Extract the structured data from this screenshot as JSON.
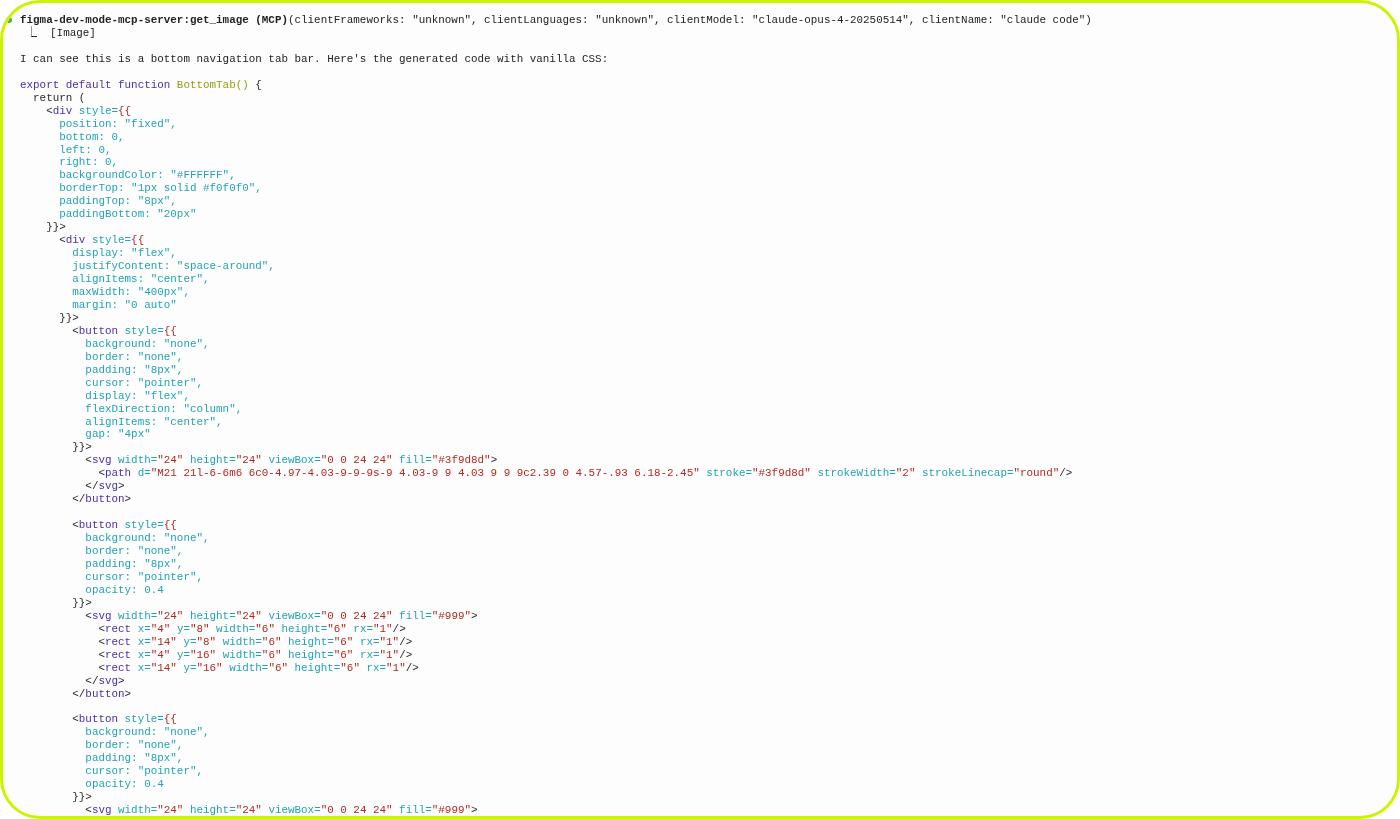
{
  "tool_call": {
    "title": "**figma-dev-mode-mcp-server:get_image (MCP)**(clientFrameworks: \"unknown\", clientLanguages: \"unknown\", clientModel: \"claude-opus-4-20250514\", clientName: \"claude code\")",
    "result": "⎿  [Image]"
  },
  "message": "I can see this is a bottom navigation tab bar. Here's the generated code with vanilla CSS:",
  "code_lines": [
    {
      "kind": "code",
      "tokens": [
        {
          "kind": "keyword",
          "text": "export default function "
        },
        {
          "kind": "function",
          "text": "BottomTab()"
        },
        {
          "kind": "plain",
          "text": " {"
        }
      ]
    },
    {
      "kind": "code",
      "tokens": [
        {
          "kind": "plain",
          "text": "  return ("
        }
      ]
    },
    {
      "kind": "code",
      "tokens": [
        {
          "kind": "plain",
          "text": "    <"
        },
        {
          "kind": "tag",
          "text": "div"
        },
        {
          "kind": "attribute",
          "text": " style="
        },
        {
          "kind": "brace",
          "text": "{{"
        }
      ]
    },
    {
      "kind": "code",
      "tokens": [
        {
          "kind": "attribute",
          "text": "      position: \"fixed\","
        }
      ]
    },
    {
      "kind": "code",
      "tokens": [
        {
          "kind": "attribute",
          "text": "      bottom: 0,"
        }
      ]
    },
    {
      "kind": "code",
      "tokens": [
        {
          "kind": "attribute",
          "text": "      left: 0,"
        }
      ]
    },
    {
      "kind": "code",
      "tokens": [
        {
          "kind": "attribute",
          "text": "      right: 0,"
        }
      ]
    },
    {
      "kind": "code",
      "tokens": [
        {
          "kind": "attribute",
          "text": "      backgroundColor: \"#FFFFFF\","
        }
      ]
    },
    {
      "kind": "code",
      "tokens": [
        {
          "kind": "attribute",
          "text": "      borderTop: \"1px solid #f0f0f0\","
        }
      ]
    },
    {
      "kind": "code",
      "tokens": [
        {
          "kind": "attribute",
          "text": "      paddingTop: \"8px\","
        }
      ]
    },
    {
      "kind": "code",
      "tokens": [
        {
          "kind": "attribute",
          "text": "      paddingBottom: \"20px\""
        }
      ]
    },
    {
      "kind": "code",
      "tokens": [
        {
          "kind": "plain",
          "text": "    }}>"
        }
      ]
    },
    {
      "kind": "code",
      "tokens": [
        {
          "kind": "plain",
          "text": "      <"
        },
        {
          "kind": "tag",
          "text": "div"
        },
        {
          "kind": "attribute",
          "text": " style="
        },
        {
          "kind": "brace",
          "text": "{{"
        }
      ]
    },
    {
      "kind": "code",
      "tokens": [
        {
          "kind": "attribute",
          "text": "        display: \"flex\","
        }
      ]
    },
    {
      "kind": "code",
      "tokens": [
        {
          "kind": "attribute",
          "text": "        justifyContent: \"space-around\","
        }
      ]
    },
    {
      "kind": "code",
      "tokens": [
        {
          "kind": "attribute",
          "text": "        alignItems: \"center\","
        }
      ]
    },
    {
      "kind": "code",
      "tokens": [
        {
          "kind": "attribute",
          "text": "        maxWidth: \"400px\","
        }
      ]
    },
    {
      "kind": "code",
      "tokens": [
        {
          "kind": "attribute",
          "text": "        margin: \"0 auto\""
        }
      ]
    },
    {
      "kind": "code",
      "tokens": [
        {
          "kind": "plain",
          "text": "      }}>"
        }
      ]
    },
    {
      "kind": "code",
      "tokens": [
        {
          "kind": "plain",
          "text": "        <"
        },
        {
          "kind": "tag",
          "text": "button"
        },
        {
          "kind": "attribute",
          "text": " style="
        },
        {
          "kind": "brace",
          "text": "{{"
        }
      ]
    },
    {
      "kind": "code",
      "tokens": [
        {
          "kind": "attribute",
          "text": "          background: \"none\","
        }
      ]
    },
    {
      "kind": "code",
      "tokens": [
        {
          "kind": "attribute",
          "text": "          border: \"none\","
        }
      ]
    },
    {
      "kind": "code",
      "tokens": [
        {
          "kind": "attribute",
          "text": "          padding: \"8px\","
        }
      ]
    },
    {
      "kind": "code",
      "tokens": [
        {
          "kind": "attribute",
          "text": "          cursor: \"pointer\","
        }
      ]
    },
    {
      "kind": "code",
      "tokens": [
        {
          "kind": "attribute",
          "text": "          display: \"flex\","
        }
      ]
    },
    {
      "kind": "code",
      "tokens": [
        {
          "kind": "attribute",
          "text": "          flexDirection: \"column\","
        }
      ]
    },
    {
      "kind": "code",
      "tokens": [
        {
          "kind": "attribute",
          "text": "          alignItems: \"center\","
        }
      ]
    },
    {
      "kind": "code",
      "tokens": [
        {
          "kind": "attribute",
          "text": "          gap: \"4px\""
        }
      ]
    },
    {
      "kind": "code",
      "tokens": [
        {
          "kind": "plain",
          "text": "        }}>"
        }
      ]
    },
    {
      "kind": "code",
      "tokens": [
        {
          "kind": "plain",
          "text": "          <"
        },
        {
          "kind": "tag",
          "text": "svg"
        },
        {
          "kind": "attribute",
          "text": " width="
        },
        {
          "kind": "string",
          "text": "\"24\""
        },
        {
          "kind": "attribute",
          "text": " height="
        },
        {
          "kind": "string",
          "text": "\"24\""
        },
        {
          "kind": "attribute",
          "text": " viewBox="
        },
        {
          "kind": "string",
          "text": "\"0 0 24 24\""
        },
        {
          "kind": "attribute",
          "text": " fill="
        },
        {
          "kind": "string",
          "text": "\"#3f9d8d\""
        },
        {
          "kind": "plain",
          "text": ">"
        }
      ]
    },
    {
      "kind": "code",
      "tokens": [
        {
          "kind": "plain",
          "text": "            <"
        },
        {
          "kind": "tag",
          "text": "path"
        },
        {
          "kind": "attribute",
          "text": " d="
        },
        {
          "kind": "string",
          "text": "\"M21 21l-6-6m6 6c0-4.97-4.03-9-9-9s-9 4.03-9 9 4.03 9 9 9c2.39 0 4.57-.93 6.18-2.45\""
        },
        {
          "kind": "attribute",
          "text": " stroke="
        },
        {
          "kind": "string",
          "text": "\"#3f9d8d\""
        },
        {
          "kind": "attribute",
          "text": " strokeWidth="
        },
        {
          "kind": "string",
          "text": "\"2\""
        },
        {
          "kind": "attribute",
          "text": " strokeLinecap="
        },
        {
          "kind": "string",
          "text": "\"round\""
        },
        {
          "kind": "plain",
          "text": "/>"
        }
      ]
    },
    {
      "kind": "code",
      "tokens": [
        {
          "kind": "plain",
          "text": "          </"
        },
        {
          "kind": "tag",
          "text": "svg"
        },
        {
          "kind": "plain",
          "text": ">"
        }
      ]
    },
    {
      "kind": "code",
      "tokens": [
        {
          "kind": "plain",
          "text": "        </"
        },
        {
          "kind": "tag",
          "text": "button"
        },
        {
          "kind": "plain",
          "text": ">"
        }
      ]
    },
    {
      "kind": "blank"
    },
    {
      "kind": "code",
      "tokens": [
        {
          "kind": "plain",
          "text": "        <"
        },
        {
          "kind": "tag",
          "text": "button"
        },
        {
          "kind": "attribute",
          "text": " style="
        },
        {
          "kind": "brace",
          "text": "{{"
        }
      ]
    },
    {
      "kind": "code",
      "tokens": [
        {
          "kind": "attribute",
          "text": "          background: \"none\","
        }
      ]
    },
    {
      "kind": "code",
      "tokens": [
        {
          "kind": "attribute",
          "text": "          border: \"none\","
        }
      ]
    },
    {
      "kind": "code",
      "tokens": [
        {
          "kind": "attribute",
          "text": "          padding: \"8px\","
        }
      ]
    },
    {
      "kind": "code",
      "tokens": [
        {
          "kind": "attribute",
          "text": "          cursor: \"pointer\","
        }
      ]
    },
    {
      "kind": "code",
      "tokens": [
        {
          "kind": "attribute",
          "text": "          opacity: 0.4"
        }
      ]
    },
    {
      "kind": "code",
      "tokens": [
        {
          "kind": "plain",
          "text": "        }}>"
        }
      ]
    },
    {
      "kind": "code",
      "tokens": [
        {
          "kind": "plain",
          "text": "          <"
        },
        {
          "kind": "tag",
          "text": "svg"
        },
        {
          "kind": "attribute",
          "text": " width="
        },
        {
          "kind": "string",
          "text": "\"24\""
        },
        {
          "kind": "attribute",
          "text": " height="
        },
        {
          "kind": "string",
          "text": "\"24\""
        },
        {
          "kind": "attribute",
          "text": " viewBox="
        },
        {
          "kind": "string",
          "text": "\"0 0 24 24\""
        },
        {
          "kind": "attribute",
          "text": " fill="
        },
        {
          "kind": "string",
          "text": "\"#999\""
        },
        {
          "kind": "plain",
          "text": ">"
        }
      ]
    },
    {
      "kind": "code",
      "tokens": [
        {
          "kind": "plain",
          "text": "            <"
        },
        {
          "kind": "tag",
          "text": "rect"
        },
        {
          "kind": "attribute",
          "text": " x="
        },
        {
          "kind": "string",
          "text": "\"4\""
        },
        {
          "kind": "attribute",
          "text": " y="
        },
        {
          "kind": "string",
          "text": "\"8\""
        },
        {
          "kind": "attribute",
          "text": " width="
        },
        {
          "kind": "string",
          "text": "\"6\""
        },
        {
          "kind": "attribute",
          "text": " height="
        },
        {
          "kind": "string",
          "text": "\"6\""
        },
        {
          "kind": "attribute",
          "text": " rx="
        },
        {
          "kind": "string",
          "text": "\"1\""
        },
        {
          "kind": "plain",
          "text": "/>"
        }
      ]
    },
    {
      "kind": "code",
      "tokens": [
        {
          "kind": "plain",
          "text": "            <"
        },
        {
          "kind": "tag",
          "text": "rect"
        },
        {
          "kind": "attribute",
          "text": " x="
        },
        {
          "kind": "string",
          "text": "\"14\""
        },
        {
          "kind": "attribute",
          "text": " y="
        },
        {
          "kind": "string",
          "text": "\"8\""
        },
        {
          "kind": "attribute",
          "text": " width="
        },
        {
          "kind": "string",
          "text": "\"6\""
        },
        {
          "kind": "attribute",
          "text": " height="
        },
        {
          "kind": "string",
          "text": "\"6\""
        },
        {
          "kind": "attribute",
          "text": " rx="
        },
        {
          "kind": "string",
          "text": "\"1\""
        },
        {
          "kind": "plain",
          "text": "/>"
        }
      ]
    },
    {
      "kind": "code",
      "tokens": [
        {
          "kind": "plain",
          "text": "            <"
        },
        {
          "kind": "tag",
          "text": "rect"
        },
        {
          "kind": "attribute",
          "text": " x="
        },
        {
          "kind": "string",
          "text": "\"4\""
        },
        {
          "kind": "attribute",
          "text": " y="
        },
        {
          "kind": "string",
          "text": "\"16\""
        },
        {
          "kind": "attribute",
          "text": " width="
        },
        {
          "kind": "string",
          "text": "\"6\""
        },
        {
          "kind": "attribute",
          "text": " height="
        },
        {
          "kind": "string",
          "text": "\"6\""
        },
        {
          "kind": "attribute",
          "text": " rx="
        },
        {
          "kind": "string",
          "text": "\"1\""
        },
        {
          "kind": "plain",
          "text": "/>"
        }
      ]
    },
    {
      "kind": "code",
      "tokens": [
        {
          "kind": "plain",
          "text": "            <"
        },
        {
          "kind": "tag",
          "text": "rect"
        },
        {
          "kind": "attribute",
          "text": " x="
        },
        {
          "kind": "string",
          "text": "\"14\""
        },
        {
          "kind": "attribute",
          "text": " y="
        },
        {
          "kind": "string",
          "text": "\"16\""
        },
        {
          "kind": "attribute",
          "text": " width="
        },
        {
          "kind": "string",
          "text": "\"6\""
        },
        {
          "kind": "attribute",
          "text": " height="
        },
        {
          "kind": "string",
          "text": "\"6\""
        },
        {
          "kind": "attribute",
          "text": " rx="
        },
        {
          "kind": "string",
          "text": "\"1\""
        },
        {
          "kind": "plain",
          "text": "/>"
        }
      ]
    },
    {
      "kind": "code",
      "tokens": [
        {
          "kind": "plain",
          "text": "          </"
        },
        {
          "kind": "tag",
          "text": "svg"
        },
        {
          "kind": "plain",
          "text": ">"
        }
      ]
    },
    {
      "kind": "code",
      "tokens": [
        {
          "kind": "plain",
          "text": "        </"
        },
        {
          "kind": "tag",
          "text": "button"
        },
        {
          "kind": "plain",
          "text": ">"
        }
      ]
    },
    {
      "kind": "blank"
    },
    {
      "kind": "code",
      "tokens": [
        {
          "kind": "plain",
          "text": "        <"
        },
        {
          "kind": "tag",
          "text": "button"
        },
        {
          "kind": "attribute",
          "text": " style="
        },
        {
          "kind": "brace",
          "text": "{{"
        }
      ]
    },
    {
      "kind": "code",
      "tokens": [
        {
          "kind": "attribute",
          "text": "          background: \"none\","
        }
      ]
    },
    {
      "kind": "code",
      "tokens": [
        {
          "kind": "attribute",
          "text": "          border: \"none\","
        }
      ]
    },
    {
      "kind": "code",
      "tokens": [
        {
          "kind": "attribute",
          "text": "          padding: \"8px\","
        }
      ]
    },
    {
      "kind": "code",
      "tokens": [
        {
          "kind": "attribute",
          "text": "          cursor: \"pointer\","
        }
      ]
    },
    {
      "kind": "code",
      "tokens": [
        {
          "kind": "attribute",
          "text": "          opacity: 0.4"
        }
      ]
    },
    {
      "kind": "code",
      "tokens": [
        {
          "kind": "plain",
          "text": "        }}>"
        }
      ]
    },
    {
      "kind": "code",
      "tokens": [
        {
          "kind": "plain",
          "text": "          <"
        },
        {
          "kind": "tag",
          "text": "svg"
        },
        {
          "kind": "attribute",
          "text": " width="
        },
        {
          "kind": "string",
          "text": "\"24\""
        },
        {
          "kind": "attribute",
          "text": " height="
        },
        {
          "kind": "string",
          "text": "\"24\""
        },
        {
          "kind": "attribute",
          "text": " viewBox="
        },
        {
          "kind": "string",
          "text": "\"0 0 24 24\""
        },
        {
          "kind": "attribute",
          "text": " fill="
        },
        {
          "kind": "string",
          "text": "\"#999\""
        },
        {
          "kind": "plain",
          "text": ">"
        }
      ]
    }
  ]
}
